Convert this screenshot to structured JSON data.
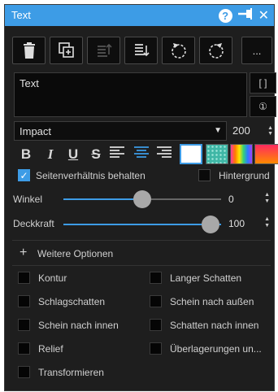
{
  "panel": {
    "title": "Text",
    "help_label": "?",
    "pin_glyph": "➔",
    "close_glyph": "✕"
  },
  "toolbar": {
    "buttons": [
      {
        "icon": "trash-icon"
      },
      {
        "icon": "duplicate-icon"
      },
      {
        "icon": "bring-forward-icon"
      },
      {
        "icon": "send-backward-icon"
      },
      {
        "icon": "rotate-left-icon"
      },
      {
        "icon": "rotate-right-icon"
      },
      {
        "icon": "more-icon",
        "label": "..."
      }
    ]
  },
  "text_input": {
    "value": "Text"
  },
  "side_buttons": {
    "bracket_label": "[ ]",
    "number_label": "①"
  },
  "font": {
    "family": "Impact",
    "size": "200"
  },
  "format": {
    "bold": "B",
    "italic": "I",
    "underline": "U",
    "strike": "S"
  },
  "swatches": {
    "white": "#ffffff",
    "teal": "#4cc2b0",
    "gradient": "rainbow",
    "fire": "orange-red"
  },
  "checkboxes": {
    "keep_ratio": {
      "label": "Seitenverhältnis behalten",
      "checked": true
    },
    "background": {
      "label": "Hintergrund",
      "checked": false
    }
  },
  "sliders": {
    "angle": {
      "label": "Winkel",
      "value": "0",
      "fraction": 0.5
    },
    "opacity": {
      "label": "Deckkraft",
      "value": "100",
      "fraction": 1.0
    }
  },
  "more_options": {
    "plus": "+",
    "label": "Weitere Optionen"
  },
  "options": [
    {
      "label": "Kontur",
      "checked": false
    },
    {
      "label": "Langer Schatten",
      "checked": false
    },
    {
      "label": "Schlagschatten",
      "checked": false
    },
    {
      "label": "Schein nach außen",
      "checked": false
    },
    {
      "label": "Schein nach innen",
      "checked": false
    },
    {
      "label": "Schatten nach innen",
      "checked": false
    },
    {
      "label": "Relief",
      "checked": false
    },
    {
      "label": "Überlagerungen un...",
      "checked": false
    },
    {
      "label": "Transformieren",
      "checked": false
    }
  ],
  "colors": {
    "accent": "#3d9ce6",
    "panel_bg": "#1e1e1e"
  }
}
